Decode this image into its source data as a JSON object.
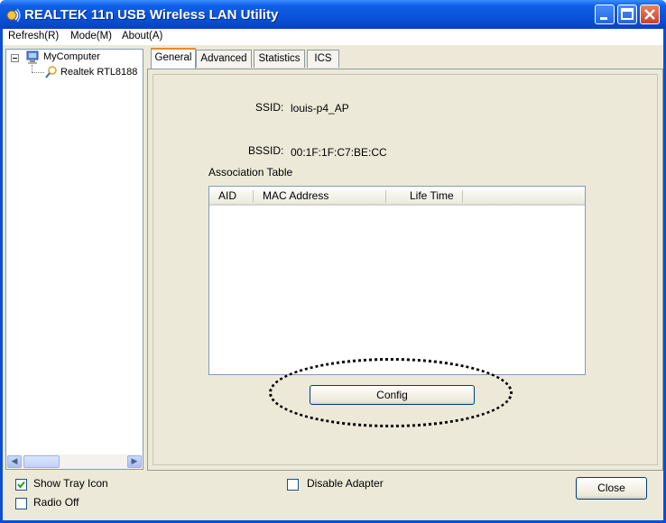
{
  "window": {
    "title": "REALTEK 11n USB Wireless LAN Utility",
    "controls": {
      "minimize_icon": "minimize-icon",
      "maximize_icon": "maximize-icon",
      "close_icon": "close-icon"
    }
  },
  "menubar": {
    "items": [
      {
        "label": "Refresh(R)"
      },
      {
        "label": "Mode(M)"
      },
      {
        "label": "About(A)"
      }
    ]
  },
  "tree": {
    "root": {
      "label": "MyComputer",
      "icon": "computer-icon",
      "expanded": true
    },
    "child": {
      "label": "Realtek RTL8188",
      "icon": "wireless-adapter-icon"
    }
  },
  "tabs": [
    {
      "label": "General",
      "active": true
    },
    {
      "label": "Advanced",
      "active": false
    },
    {
      "label": "Statistics",
      "active": false
    },
    {
      "label": "ICS",
      "active": false
    }
  ],
  "general": {
    "ssid_label": "SSID:",
    "ssid_value": "louis-p4_AP",
    "bssid_label": "BSSID:",
    "bssid_value": "00:1F:1F:C7:BE:CC",
    "association_table_label": "Association Table",
    "columns": [
      "AID",
      "MAC Address",
      "Life Time"
    ],
    "rows": [],
    "config_button": "Config"
  },
  "footer": {
    "show_tray_icon": {
      "label": "Show Tray Icon",
      "checked": true
    },
    "radio_off": {
      "label": "Radio Off",
      "checked": false
    },
    "disable_adapter": {
      "label": "Disable Adapter",
      "checked": false
    },
    "close_button": "Close"
  },
  "colors": {
    "titlebar": "#0a52d8",
    "client_bg": "#ece9d8",
    "active_tab_accent": "#e68b2c",
    "checkmark": "#21a121"
  }
}
